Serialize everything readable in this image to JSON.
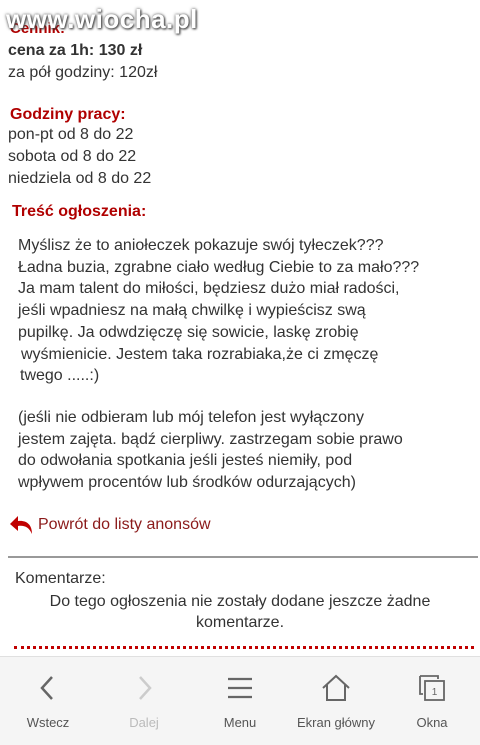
{
  "watermark": "www.wiocha.pl",
  "price": {
    "heading": "Cennik:",
    "hour": "cena za 1h: 130 zł",
    "half": "za pół godziny: 120zł"
  },
  "hours": {
    "heading": "Godziny pracy:",
    "weekdays": "pon-pt od 8 do 22",
    "saturday": "sobota od 8 do 22",
    "sunday": "niedziela od 8 do 22"
  },
  "ad": {
    "heading": "Treść ogłoszenia:",
    "paragraph1_lines": [
      "Myślisz że to aniołeczek pokazuje swój tyłeczek???",
      "Ładna buzia, zgrabne ciało według Ciebie to za mało???",
      "Ja mam talent do miłości, będziesz dużo miał radości,",
      "jeśli wpadniesz na małą chwilkę i wypieścisz swą",
      "pupilkę. Ja odwdzięczę się sowicie, laskę zrobię",
      "wyśmienicie. Jestem taka rozrabiaka,że ci zmęczę",
      "twego .....:)"
    ],
    "paragraph2_lines": [
      "(jeśli nie odbieram lub mój telefon jest wyłączony",
      "jestem zajęta. bądź cierpliwy. zastrzegam sobie prawo",
      "do odwołania spotkania jeśli jesteś niemiły, pod",
      "wpływem procentów lub środków odurzających)"
    ]
  },
  "back_link": "Powrót do listy anonsów",
  "comments": {
    "label": "Komentarze:",
    "empty_line1": "Do tego ogłoszenia nie zostały dodane jeszcze żadne",
    "empty_line2": "komentarze."
  },
  "toolbar": {
    "back": "Wstecz",
    "forward": "Dalej",
    "menu": "Menu",
    "home": "Ekran główny",
    "windows": "Okna",
    "windows_count": "1"
  },
  "colors": {
    "heading_red": "#b00000",
    "link_red": "#8b1a1a",
    "dotted_red": "#c00000"
  }
}
